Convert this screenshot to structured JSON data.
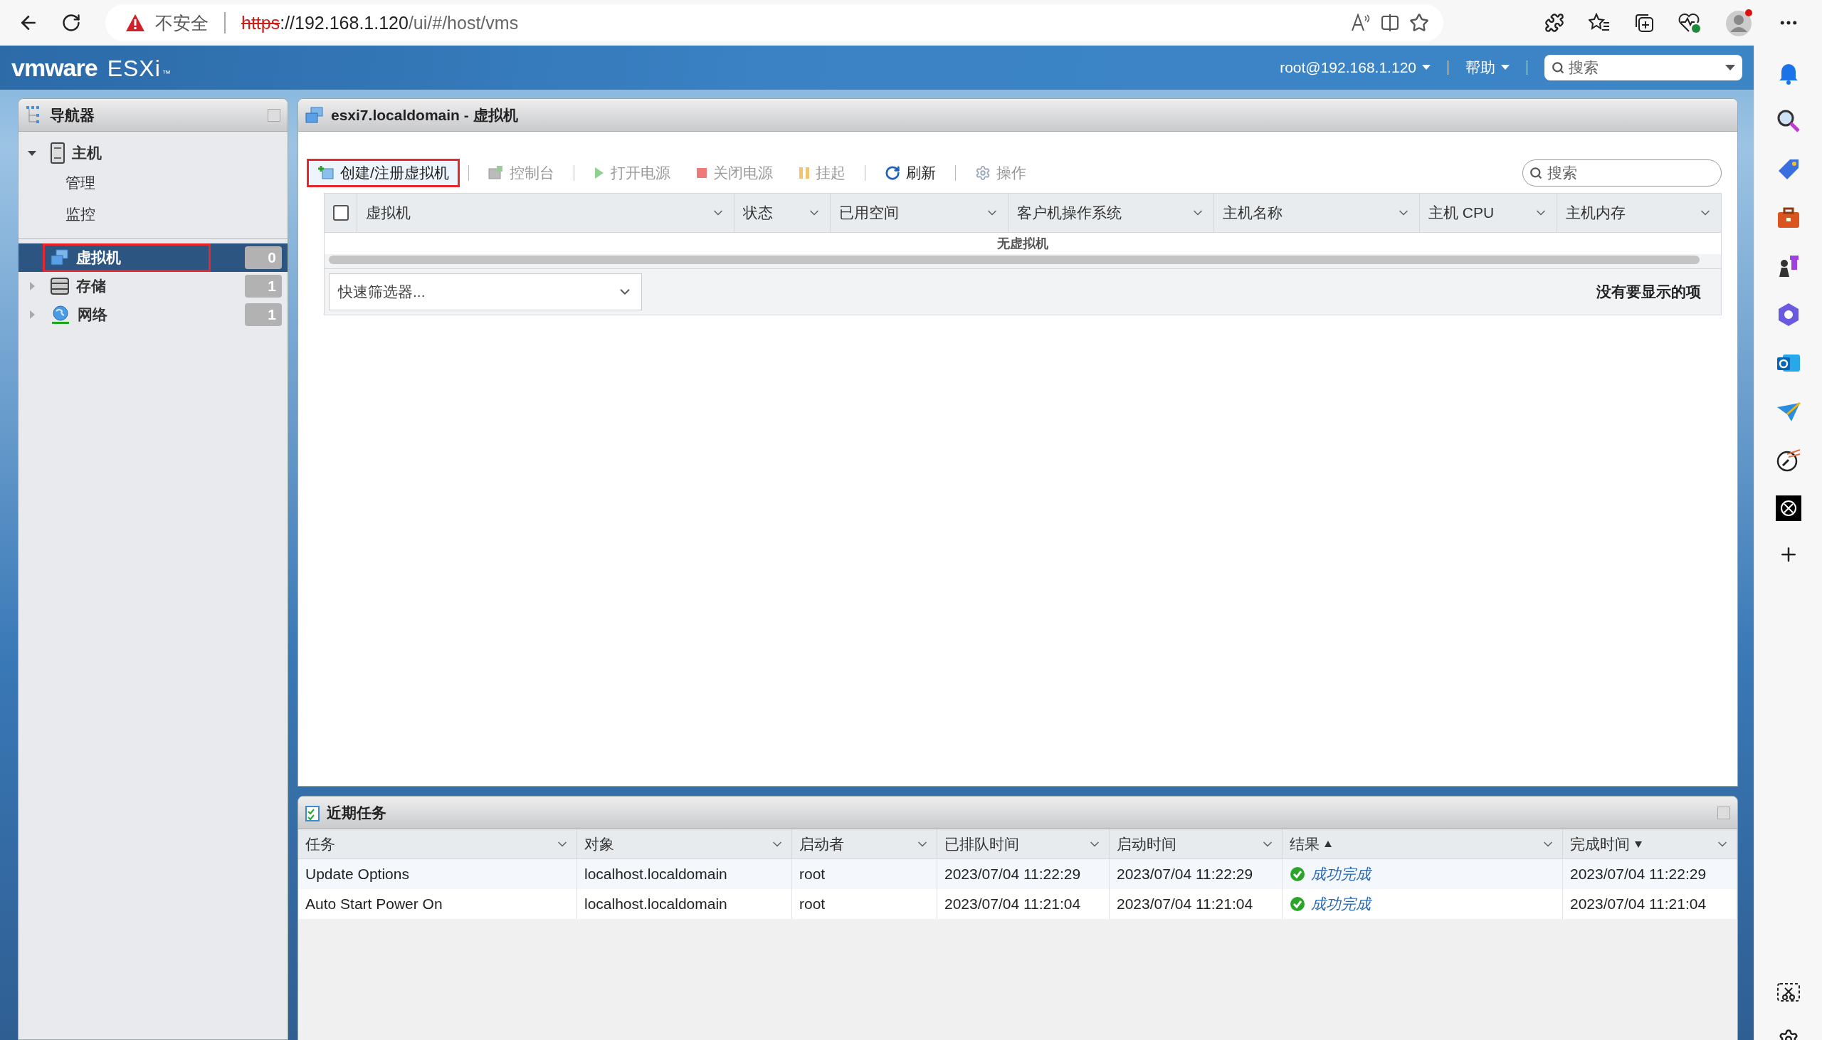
{
  "browser": {
    "security_label": "不安全",
    "url": {
      "scheme": "https",
      "host": "://192.168.1.120",
      "path": "/ui/#/host/vms"
    }
  },
  "header": {
    "logo": {
      "brand": "vmware",
      "product": "ESXi",
      "mark": "™"
    },
    "user_menu": "root@192.168.1.120",
    "help_menu": "帮助",
    "search": {
      "placeholder": "搜索"
    }
  },
  "navigator": {
    "title": "导航器",
    "items": [
      {
        "label": "主机",
        "kind": "host",
        "expanded": true,
        "selected": false,
        "annotated": false,
        "children": [
          {
            "label": "管理",
            "selected": false
          },
          {
            "label": "监控",
            "selected": false
          }
        ]
      },
      {
        "label": "虚拟机",
        "kind": "vm",
        "selected": true,
        "annotated": true,
        "count": "0"
      },
      {
        "label": "存储",
        "kind": "storage",
        "expanded": false,
        "selected": false,
        "annotated": false,
        "count": "1"
      },
      {
        "label": "网络",
        "kind": "network",
        "expanded": false,
        "selected": false,
        "annotated": false,
        "count": "1"
      }
    ]
  },
  "main": {
    "title": "esxi7.localdomain - 虚拟机",
    "toolbar": [
      {
        "label": "创建/注册虚拟机",
        "kind": "create",
        "disabled": false,
        "annotated": true
      },
      {
        "label": "控制台",
        "kind": "console",
        "disabled": true,
        "annotated": false
      },
      {
        "label": "打开电源",
        "kind": "power-on",
        "disabled": true,
        "annotated": false
      },
      {
        "label": "关闭电源",
        "kind": "power-off",
        "disabled": true,
        "annotated": false
      },
      {
        "label": "挂起",
        "kind": "suspend",
        "disabled": true,
        "annotated": false
      },
      {
        "label": "刷新",
        "kind": "refresh",
        "disabled": false,
        "annotated": false
      },
      {
        "label": "操作",
        "kind": "actions",
        "disabled": true,
        "annotated": false
      }
    ],
    "search": {
      "placeholder": "搜索"
    },
    "table": {
      "select_all": {
        "checked": false
      },
      "columns": [
        "虚拟机",
        "状态",
        "已用空间",
        "客户机操作系统",
        "主机名称",
        "主机 CPU",
        "主机内存"
      ],
      "empty_message": "无虚拟机"
    },
    "quick_filter": {
      "placeholder": "快速筛选器..."
    },
    "footer_text": "没有要显示的项"
  },
  "recent_tasks": {
    "title": "近期任务",
    "columns": [
      {
        "label": "任务",
        "sort_ascending": false,
        "sort_descending": false
      },
      {
        "label": "对象",
        "sort_ascending": false,
        "sort_descending": false
      },
      {
        "label": "启动者",
        "sort_ascending": false,
        "sort_descending": false
      },
      {
        "label": "已排队时间",
        "sort_ascending": false,
        "sort_descending": false
      },
      {
        "label": "启动时间",
        "sort_ascending": false,
        "sort_descending": false
      },
      {
        "label": "结果",
        "sort_ascending": true,
        "sort_descending": false
      },
      {
        "label": "完成时间",
        "sort_ascending": false,
        "sort_descending": true
      }
    ],
    "rows": [
      {
        "task": "Update Options",
        "target": "localhost.localdomain",
        "initiator": "root",
        "queued": "2023/07/04 11:22:29",
        "started": "2023/07/04 11:22:29",
        "result": {
          "kind": "success",
          "text": "成功完成"
        },
        "completed": "2023/07/04 11:22:29"
      },
      {
        "task": "Auto Start Power On",
        "target": "localhost.localdomain",
        "initiator": "root",
        "queued": "2023/07/04 11:21:04",
        "started": "2023/07/04 11:21:04",
        "result": {
          "kind": "success",
          "text": "成功完成"
        },
        "completed": "2023/07/04 11:21:04"
      }
    ]
  }
}
